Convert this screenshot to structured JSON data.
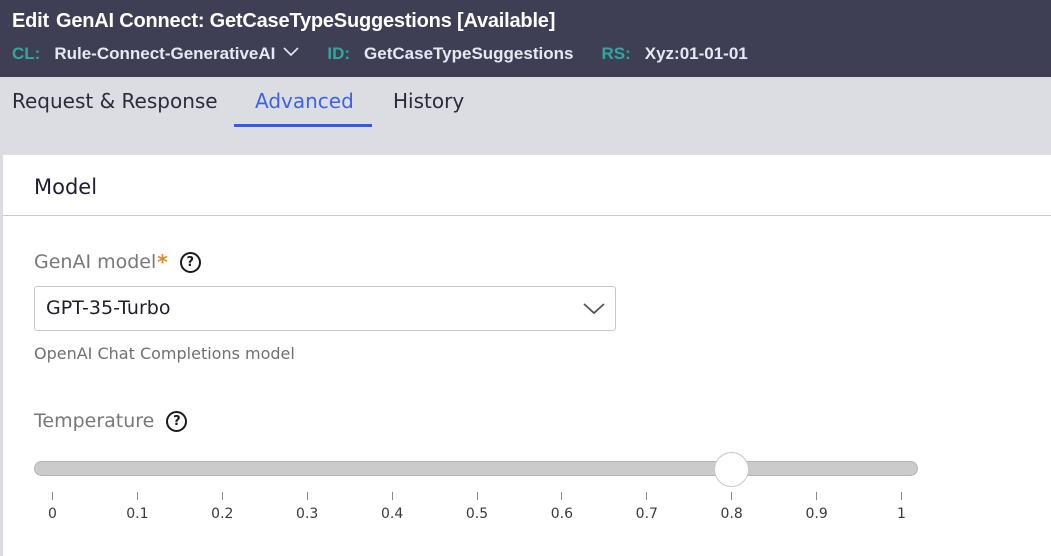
{
  "header": {
    "edit_label": "Edit",
    "title": "GenAI Connect: GetCaseTypeSuggestions",
    "status": "[Available]",
    "meta": {
      "class_key": "CL:",
      "class_value": "Rule-Connect-GenerativeAI",
      "id_key": "ID:",
      "id_value": "GetCaseTypeSuggestions",
      "ruleset_key": "RS:",
      "ruleset_value": "Xyz:01-01-01"
    }
  },
  "tabs": [
    {
      "label": "Request & Response",
      "active": false
    },
    {
      "label": "Advanced",
      "active": true
    },
    {
      "label": "History",
      "active": false
    }
  ],
  "section": {
    "title": "Model"
  },
  "genai_model": {
    "label": "GenAI model",
    "required_marker": "*",
    "help_icon": "?",
    "value": "GPT-35-Turbo",
    "helper_text": "OpenAI Chat Completions model"
  },
  "temperature": {
    "label": "Temperature",
    "help_icon": "?",
    "min": 0,
    "max": 1,
    "value": 0.8,
    "tick_labels": [
      "0",
      "0.1",
      "0.2",
      "0.3",
      "0.4",
      "0.5",
      "0.6",
      "0.7",
      "0.8",
      "0.9",
      "1"
    ]
  },
  "colors": {
    "header_bg": "#3e3f55",
    "meta_key": "#2ea8a0",
    "active_tab": "#3d62e6",
    "required_star": "#e08a2c"
  }
}
